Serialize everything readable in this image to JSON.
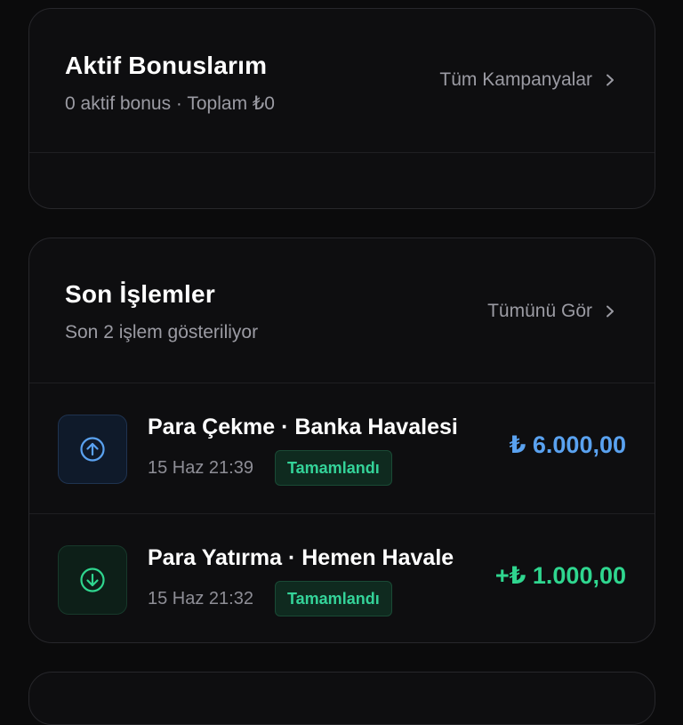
{
  "bonus": {
    "title": "Aktif Bonuslarım",
    "subtitle": "0 aktif bonus · Toplam ₺0",
    "link_label": "Tüm Kampanyalar"
  },
  "transactions": {
    "title": "Son İşlemler",
    "subtitle": "Son 2 işlem gösteriliyor",
    "link_label": "Tümünü Gör",
    "items": [
      {
        "type": "withdraw",
        "icon": "arrow-up-circle-icon",
        "name": "Para Çekme · Banka Havalesi",
        "date": "15 Haz 21:39",
        "status": "Tamamlandı",
        "amount": "₺ 6.000,00"
      },
      {
        "type": "deposit",
        "icon": "arrow-down-circle-icon",
        "name": "Para Yatırma · Hemen Havale",
        "date": "15 Haz 21:32",
        "status": "Tamamlandı",
        "amount": "+₺ 1.000,00"
      }
    ]
  },
  "colors": {
    "withdraw": "#5aa2f0",
    "deposit": "#2fd68f",
    "status": "#34d399",
    "background": "#0b0b0c",
    "card": "#0e0e10"
  }
}
